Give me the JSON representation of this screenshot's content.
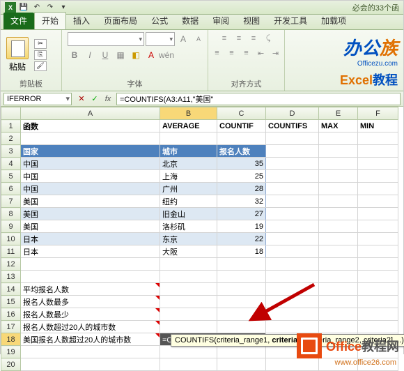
{
  "title_right": "必会的33个函",
  "tabs": {
    "file": "文件",
    "start": "开始",
    "insert": "插入",
    "layout": "页面布局",
    "formula": "公式",
    "data": "数据",
    "review": "审阅",
    "view": "视图",
    "dev": "开发工具",
    "addin": "加载项"
  },
  "groups": {
    "clipboard": "剪贴板",
    "font": "字体",
    "align": "对齐方式",
    "paste": "粘贴"
  },
  "watermark": {
    "line1_a": "办公",
    "line1_b": "族",
    "url": "Officezu.com",
    "line2_a": "Excel",
    "line2_b": "教程"
  },
  "name_box": "IFERROR",
  "formula": "=COUNTIFS(A3:A11,\"美国\"",
  "cols": [
    "A",
    "B",
    "C",
    "D",
    "E",
    "F"
  ],
  "row1": {
    "a": "函数",
    "b": "AVERAGE",
    "c": "COUNTIF",
    "d": "COUNTIFS",
    "e": "MAX",
    "f": "MIN"
  },
  "row3": {
    "a": "国家",
    "b": "城市",
    "c": "报名人数"
  },
  "data_rows": [
    {
      "a": "中国",
      "b": "北京",
      "c": 35
    },
    {
      "a": "中国",
      "b": "上海",
      "c": 25
    },
    {
      "a": "中国",
      "b": "广州",
      "c": 28
    },
    {
      "a": "美国",
      "b": "纽约",
      "c": 32
    },
    {
      "a": "美国",
      "b": "旧金山",
      "c": 27
    },
    {
      "a": "美国",
      "b": "洛杉矶",
      "c": 19
    },
    {
      "a": "日本",
      "b": "东京",
      "c": 22
    },
    {
      "a": "日本",
      "b": "大阪",
      "c": 18
    }
  ],
  "labels": {
    "r14": "平均报名人数",
    "r15": "报名人数最多",
    "r16": "报名人数最少",
    "r17": "报名人数超过20人的城市数",
    "r18": "美国报名人数超过20人的城市数"
  },
  "cell_b18": "=COUNTIFS(A3:A11,\"美国\"",
  "tooltip": {
    "pre": "COUNTIFS(criteria_range1, ",
    "bold": "criteria1",
    "post": ", [criteria_range2, criteria2],...)"
  },
  "office_logo": {
    "a": "Office",
    "b": "教程网",
    "url": "www.office26.com"
  }
}
